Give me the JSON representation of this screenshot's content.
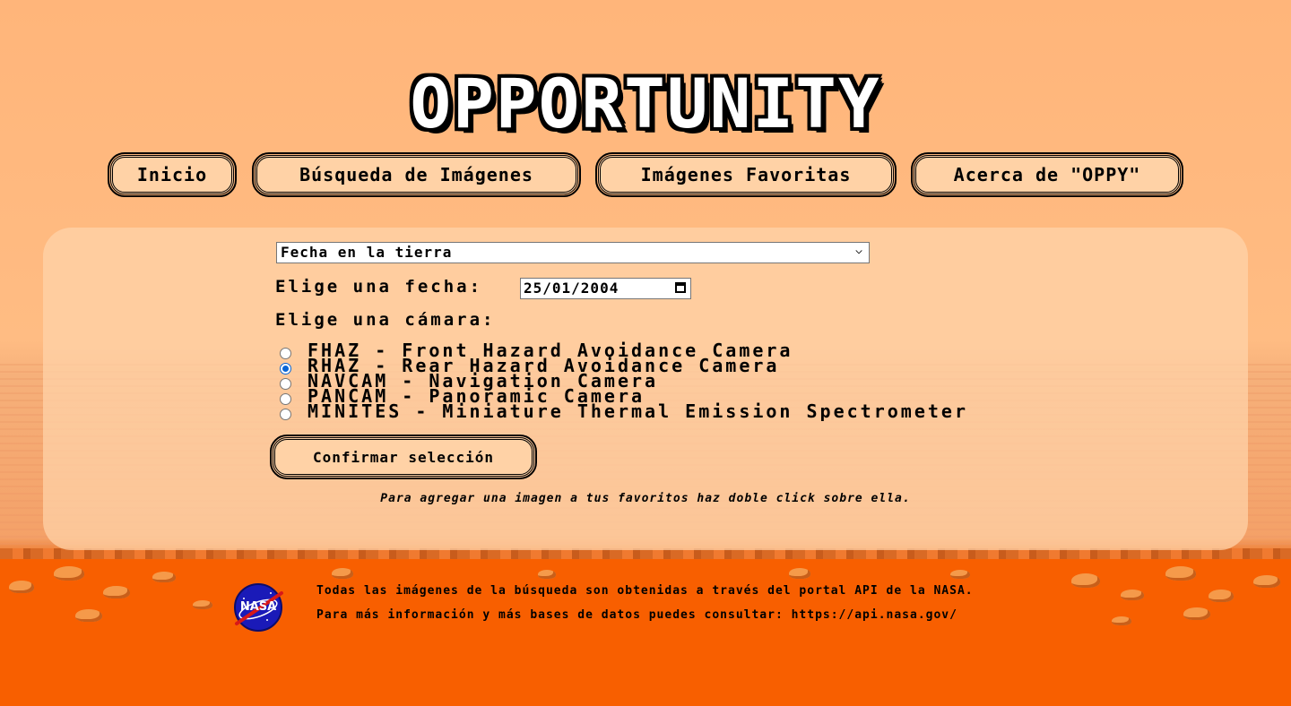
{
  "header": {
    "title": "OPPORTUNITY"
  },
  "nav": {
    "items": [
      {
        "label": "Inicio"
      },
      {
        "label": "Búsqueda de Imágenes"
      },
      {
        "label": "Imágenes Favoritas"
      },
      {
        "label": "Acerca de \"OPPY\""
      }
    ]
  },
  "search": {
    "date_mode_selected": "Fecha en la tierra",
    "date_label": "Elige una fecha:",
    "date_value": "25/01/2004",
    "camera_label": "Elige una cámara:",
    "cameras": [
      {
        "label": "FHAZ - Front Hazard Avoidance Camera",
        "checked": false
      },
      {
        "label": "RHAZ - Rear Hazard Avoidance Camera",
        "checked": true
      },
      {
        "label": "NAVCAM - Navigation Camera",
        "checked": false
      },
      {
        "label": "PANCAM - Panoramic Camera",
        "checked": false
      },
      {
        "label": "MINITES - Miniature Thermal Emission Spectrometer",
        "checked": false
      }
    ],
    "confirm_label": "Confirmar selección",
    "hint": "Para agregar una imagen a tus favoritos haz doble click sobre ella."
  },
  "footer": {
    "logo_text": "NASA",
    "line1": "Todas las imágenes de la búsqueda son obtenidas a través del portal API de la NASA.",
    "line2": "Para más información y más bases de datos puedes consultar: https://api.nasa.gov/"
  },
  "colors": {
    "sky": "#ffb57a",
    "ground": "#f75f00",
    "button_bg": "#ffd2a6",
    "radio_accent": "#0a66d6"
  }
}
